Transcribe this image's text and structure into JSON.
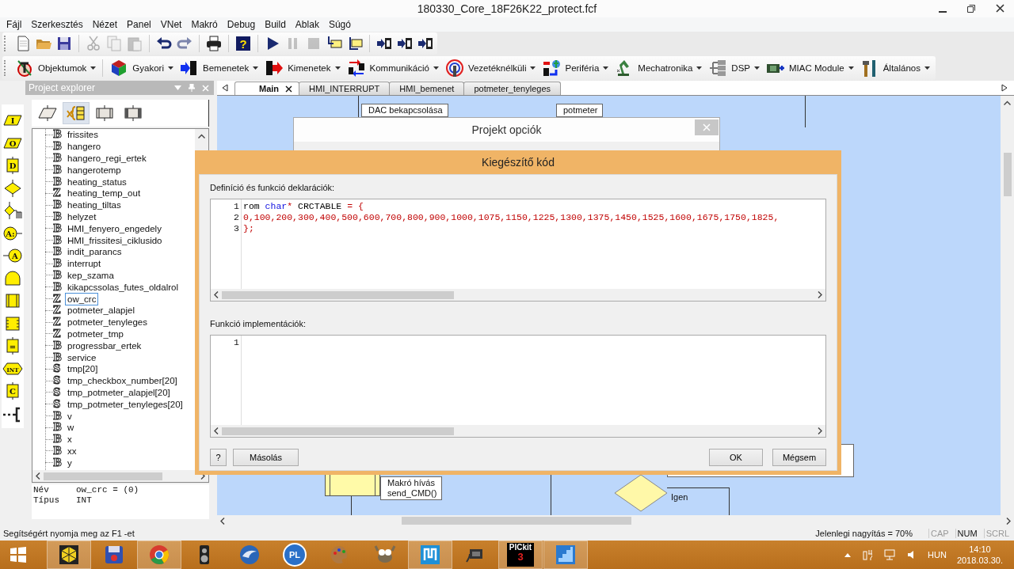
{
  "window": {
    "title": "180330_Core_18F26K22_protect.fcf"
  },
  "menu": [
    "Fájl",
    "Szerkesztés",
    "Nézet",
    "Panel",
    "VNet",
    "Makró",
    "Debug",
    "Build",
    "Ablak",
    "Súgó"
  ],
  "toolbar": [
    [
      {
        "kind": "new",
        "disabled": false
      },
      {
        "kind": "open",
        "disabled": false
      },
      {
        "kind": "save",
        "disabled": false
      }
    ],
    [
      {
        "kind": "cut",
        "disabled": true
      },
      {
        "kind": "copy",
        "disabled": true
      },
      {
        "kind": "paste",
        "disabled": true
      }
    ],
    [
      {
        "kind": "undo",
        "disabled": false
      },
      {
        "kind": "redo",
        "disabled": true
      }
    ],
    [
      {
        "kind": "print",
        "disabled": false
      }
    ],
    [
      {
        "kind": "help",
        "glyph": "?",
        "disabled": false
      }
    ],
    [
      {
        "kind": "run",
        "disabled": false
      },
      {
        "kind": "pause",
        "disabled": true
      },
      {
        "kind": "stop",
        "disabled": true
      },
      {
        "kind": "step-into",
        "disabled": false
      },
      {
        "kind": "step-over",
        "disabled": false
      }
    ],
    [
      {
        "kind": "compile-c",
        "disabled": false
      },
      {
        "kind": "compile-hex",
        "disabled": false
      },
      {
        "kind": "compile-chip",
        "disabled": false
      }
    ]
  ],
  "components": [
    {
      "kind": "objects",
      "label": "Objektumok"
    },
    {
      "kind": "common",
      "label": "Gyakori"
    },
    {
      "kind": "inputs",
      "label": "Bemenetek"
    },
    {
      "kind": "outputs",
      "label": "Kimenetek"
    },
    {
      "kind": "comms",
      "label": "Kommunikáció"
    },
    {
      "kind": "wireless",
      "label": "Vezetéknélküli"
    },
    {
      "kind": "peripheral",
      "label": "Periféria"
    },
    {
      "kind": "mechatronics",
      "label": "Mechatronika"
    },
    {
      "kind": "dsp",
      "label": "DSP"
    },
    {
      "kind": "miac",
      "label": "MIAC Module"
    },
    {
      "kind": "general",
      "label": "Általános"
    }
  ],
  "palette": [
    {
      "kind": "input",
      "label": "I"
    },
    {
      "kind": "output",
      "label": "O"
    },
    {
      "kind": "delay",
      "label": "D"
    },
    {
      "kind": "decision"
    },
    {
      "kind": "switch"
    },
    {
      "kind": "connection",
      "label": "A:"
    },
    {
      "kind": "goto",
      "label": "A"
    },
    {
      "kind": "loop"
    },
    {
      "kind": "macro"
    },
    {
      "kind": "component-macro"
    },
    {
      "kind": "calculation",
      "label": "="
    },
    {
      "kind": "interrupt",
      "label": "INT"
    },
    {
      "kind": "code",
      "label": "C"
    },
    {
      "kind": "comment"
    }
  ],
  "explorer": {
    "title": "Project explorer",
    "tabs": [
      {
        "kind": "ports",
        "selected": false
      },
      {
        "kind": "variables",
        "selected": true
      },
      {
        "kind": "macros",
        "selected": false
      },
      {
        "kind": "component-macros",
        "selected": false
      }
    ],
    "variables": [
      {
        "type": "B",
        "name": "frissites",
        "selected": false
      },
      {
        "type": "B",
        "name": "hangero",
        "selected": false
      },
      {
        "type": "B",
        "name": "hangero_regi_ertek",
        "selected": false
      },
      {
        "type": "B",
        "name": "hangerotemp",
        "selected": false
      },
      {
        "type": "B",
        "name": "heating_status",
        "selected": false
      },
      {
        "type": "Z",
        "name": "heating_temp_out",
        "selected": false
      },
      {
        "type": "B",
        "name": "heating_tiltas",
        "selected": false
      },
      {
        "type": "B",
        "name": "helyzet",
        "selected": false
      },
      {
        "type": "B",
        "name": "HMI_fenyero_engedely",
        "selected": false
      },
      {
        "type": "B",
        "name": "HMI_frissitesi_ciklusido",
        "selected": false
      },
      {
        "type": "B",
        "name": "indit_parancs",
        "selected": false
      },
      {
        "type": "B",
        "name": "interrupt",
        "selected": false
      },
      {
        "type": "B",
        "name": "kep_szama",
        "selected": false
      },
      {
        "type": "B",
        "name": "kikapcssolas_futes_oldalrol",
        "selected": false
      },
      {
        "type": "Z",
        "name": "ow_crc",
        "selected": true
      },
      {
        "type": "Z",
        "name": "potmeter_alapjel",
        "selected": false
      },
      {
        "type": "Z",
        "name": "potmeter_tenyleges",
        "selected": false
      },
      {
        "type": "Z",
        "name": "potmeter_tmp",
        "selected": false
      },
      {
        "type": "B",
        "name": "progressbar_ertek",
        "selected": false
      },
      {
        "type": "B",
        "name": "service",
        "selected": false
      },
      {
        "type": "S",
        "name": "tmp[20]",
        "selected": false
      },
      {
        "type": "S",
        "name": "tmp_checkbox_number[20]",
        "selected": false
      },
      {
        "type": "S",
        "name": "tmp_potmeter_alapjel[20]",
        "selected": false
      },
      {
        "type": "S",
        "name": "tmp_potmeter_tenyleges[20]",
        "selected": false
      },
      {
        "type": "B",
        "name": "v",
        "selected": false
      },
      {
        "type": "B",
        "name": "w",
        "selected": false
      },
      {
        "type": "B",
        "name": "x",
        "selected": false
      },
      {
        "type": "B",
        "name": "xx",
        "selected": false
      },
      {
        "type": "B",
        "name": "y",
        "selected": false
      }
    ],
    "properties": [
      {
        "label": "Név",
        "value": "ow_crc = (0)"
      },
      {
        "label": "Típus",
        "value": "INT"
      }
    ]
  },
  "tabs": [
    {
      "label": "Main",
      "selected": true
    },
    {
      "label": "HMI_INTERRUPT",
      "selected": false
    },
    {
      "label": "HMI_bemenet",
      "selected": false
    },
    {
      "label": "potmeter_tenyleges",
      "selected": false
    }
  ],
  "flowchart": {
    "comments": [
      [
        "DAC bekapcsolása"
      ],
      [
        "potmeter"
      ],
      [
        "Makró hívás",
        "send_CMD()"
      ]
    ],
    "branch_label": "Igen"
  },
  "project_options": {
    "title": "Projekt opciók"
  },
  "code_dialog": {
    "title": "Kiegészítő kód",
    "sections": [
      {
        "label": "Definíció és funkció deklarációk:",
        "lines": [
          {
            "number": "1",
            "tokens": [
              {
                "text": "rom ",
                "kind": "plain"
              },
              {
                "text": "char",
                "kind": "keyword"
              },
              {
                "text": "*",
                "kind": "operator"
              },
              {
                "text": " CRCTABLE ",
                "kind": "plain"
              },
              {
                "text": "= {",
                "kind": "operator"
              }
            ]
          },
          {
            "number": "2",
            "tokens": [
              {
                "text": "0,100,200,300,400,500,600,700,800,900,1000,1075,1150,1225,1300,1375,1450,1525,1600,1675,1750,1825,",
                "kind": "literal"
              }
            ]
          },
          {
            "number": "3",
            "tokens": [
              {
                "text": "};",
                "kind": "operator"
              }
            ]
          }
        ]
      },
      {
        "label": "Funkció implementációk:",
        "lines": [
          {
            "number": "1"
          }
        ]
      }
    ],
    "buttons": [
      {
        "kind": "help",
        "label": "?"
      },
      {
        "kind": "action",
        "label": "Másolás"
      },
      {
        "kind": "confirm",
        "label": "OK"
      },
      {
        "kind": "confirm",
        "label": "Mégsem"
      }
    ]
  },
  "status_bar": {
    "hint": "Segítségért nyomja meg az F1 -et",
    "zoom": "Jelenlegi nagyítás = 70%",
    "indicators": [
      {
        "label": "CAP",
        "on": false
      },
      {
        "label": "NUM",
        "on": true
      },
      {
        "label": "SCRL",
        "on": false
      }
    ]
  },
  "taskbar": {
    "apps": [
      {
        "kind": "cube",
        "running": true
      },
      {
        "kind": "floppy",
        "running": false
      },
      {
        "kind": "round",
        "running": true
      },
      {
        "kind": "speaker",
        "running": false
      },
      {
        "kind": "bird",
        "running": false
      },
      {
        "kind": "pl",
        "label": "PL",
        "running": false
      },
      {
        "kind": "palette",
        "running": false
      },
      {
        "kind": "animal",
        "running": false
      },
      {
        "kind": "tile",
        "running": true
      },
      {
        "kind": "device",
        "running": false
      },
      {
        "kind": "pickit",
        "label": "PICkit",
        "sublabel": "3",
        "running": true
      },
      {
        "kind": "stairs",
        "running": true
      }
    ],
    "language": "HUN",
    "time": "14:10",
    "date": "2018.03.30."
  }
}
